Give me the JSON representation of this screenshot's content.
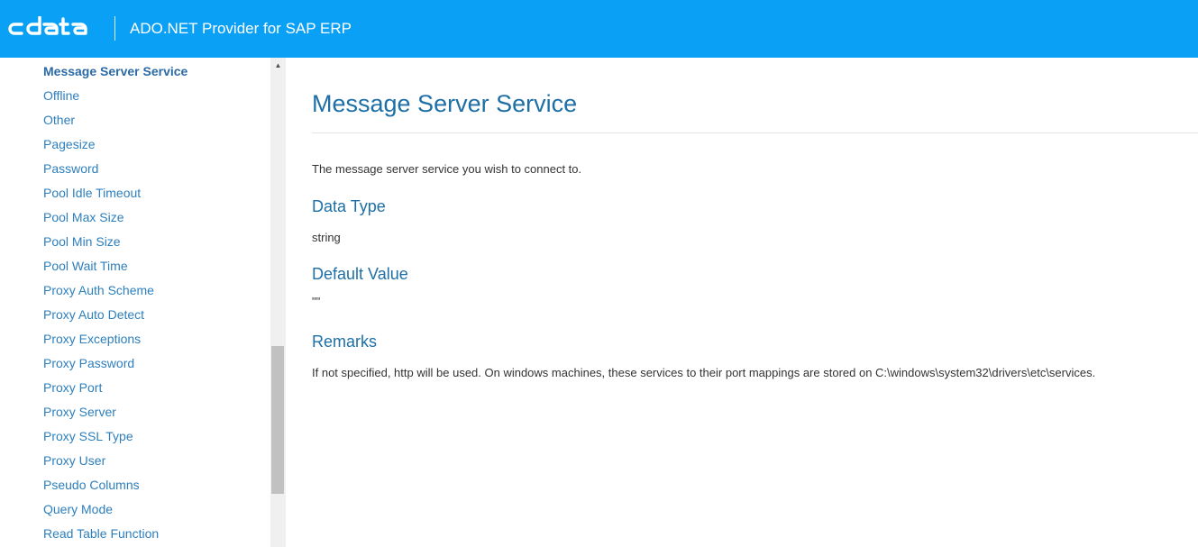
{
  "header": {
    "logo_text": "cdata",
    "title": "ADO.NET Provider for SAP ERP"
  },
  "sidebar": {
    "items": [
      {
        "label": "Message Server Service",
        "active": true
      },
      {
        "label": "Offline"
      },
      {
        "label": "Other"
      },
      {
        "label": "Pagesize"
      },
      {
        "label": "Password"
      },
      {
        "label": "Pool Idle Timeout"
      },
      {
        "label": "Pool Max Size"
      },
      {
        "label": "Pool Min Size"
      },
      {
        "label": "Pool Wait Time"
      },
      {
        "label": "Proxy Auth Scheme"
      },
      {
        "label": "Proxy Auto Detect"
      },
      {
        "label": "Proxy Exceptions"
      },
      {
        "label": "Proxy Password"
      },
      {
        "label": "Proxy Port"
      },
      {
        "label": "Proxy Server"
      },
      {
        "label": "Proxy SSL Type"
      },
      {
        "label": "Proxy User"
      },
      {
        "label": "Pseudo Columns"
      },
      {
        "label": "Query Mode"
      },
      {
        "label": "Read Table Function"
      }
    ]
  },
  "main": {
    "title": "Message Server Service",
    "description": "The message server service you wish to connect to.",
    "data_type_heading": "Data Type",
    "data_type_value": "string",
    "default_value_heading": "Default Value",
    "default_value": "\"\"",
    "remarks_heading": "Remarks",
    "remarks_text": "If not specified, http will be used. On windows machines, these services to their port mappings are stored on C:\\windows\\system32\\drivers\\etc\\services."
  },
  "colors": {
    "header_bg": "#0aa0f5",
    "link": "#2d7fbd",
    "heading": "#1d6fa5"
  }
}
